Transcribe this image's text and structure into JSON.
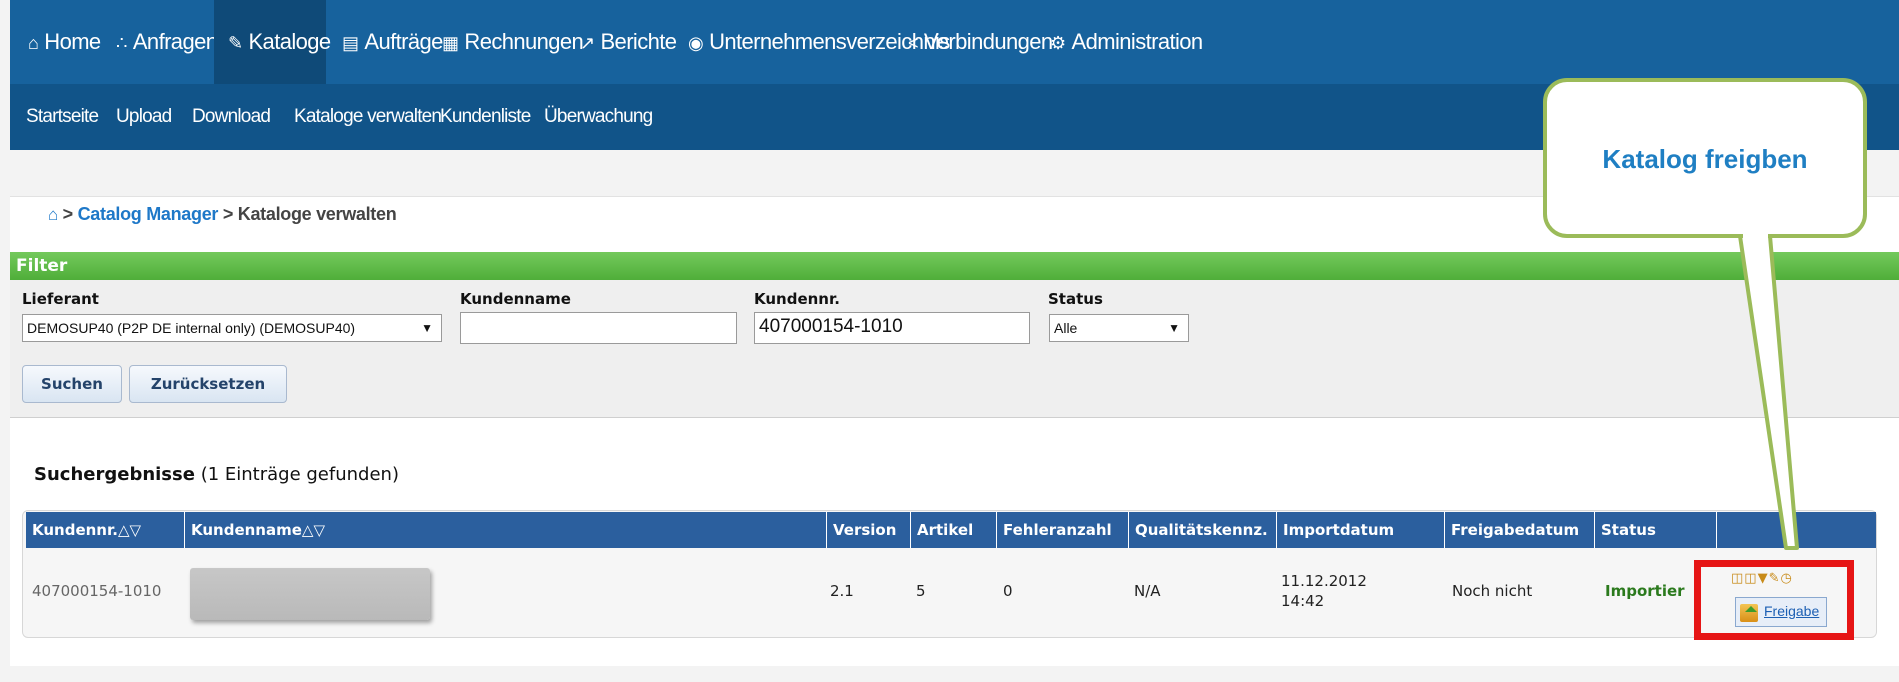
{
  "topnav": {
    "items": [
      {
        "label": "Home",
        "icon": "home-icon"
      },
      {
        "label": "Anfragen",
        "icon": "network-icon"
      },
      {
        "label": "Kataloge",
        "icon": "pen-icon"
      },
      {
        "label": "Aufträge",
        "icon": "document-icon"
      },
      {
        "label": "Rechnungen",
        "icon": "invoice-icon"
      },
      {
        "label": "Berichte",
        "icon": "chart-icon"
      },
      {
        "label": "Unternehmensverzeichnis",
        "icon": "globe-icon"
      },
      {
        "label": "Verbindungen",
        "icon": "share-icon"
      },
      {
        "label": "Administration",
        "icon": "gears-icon"
      }
    ],
    "active": "Kataloge"
  },
  "subnav": {
    "items": [
      "Startseite",
      "Upload",
      "Download",
      "Kataloge verwalten",
      "Kundenliste",
      "Überwachung"
    ]
  },
  "breadcrumb": {
    "separator1": ">",
    "link": "Catalog Manager",
    "separator2": ">",
    "current": "Kataloge verwalten"
  },
  "filter": {
    "title": "Filter",
    "lieferant_label": "Lieferant",
    "lieferant_value": "DEMOSUP40 (P2P DE internal only) (DEMOSUP40)",
    "kundenname_label": "Kundenname",
    "kundenname_value": "",
    "kundennr_label": "Kundennr.",
    "kundennr_value": "407000154-1010",
    "status_label": "Status",
    "status_value": "Alle",
    "search_button": "Suchen",
    "reset_button": "Zurücksetzen"
  },
  "results": {
    "title": "Suchergebnisse",
    "count_text": "(1 Einträge gefunden)",
    "columns": [
      "Kundennr.△▽",
      "Kundenname△▽",
      "Version",
      "Artikel",
      "Fehleranzahl",
      "Qualitätskennz.",
      "Importdatum",
      "Freigabedatum",
      "Status",
      ""
    ],
    "rows": [
      {
        "kundennr": "407000154-1010",
        "version": "2.1",
        "artikel": "5",
        "fehleranzahl": "0",
        "qualitaet": "N/A",
        "import_date": "11.12.2012",
        "import_time": "14:42",
        "freigabedatum": "Noch nicht",
        "status": "Importier",
        "release_label": "Freigabe"
      }
    ]
  },
  "callout": {
    "text": "Katalog freigben"
  },
  "colors": {
    "nav": "#17629d",
    "subnav": "#115489",
    "filter_bar": "#5bb846",
    "table_header": "#2b5f9e",
    "highlight": "#e61515",
    "callout_border": "#9bbb59",
    "callout_text": "#1f7fc3"
  }
}
